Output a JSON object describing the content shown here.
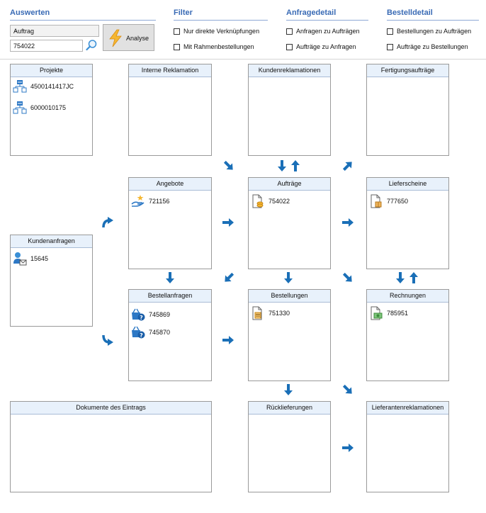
{
  "sections": {
    "auswerten": {
      "title": "Auswerten"
    },
    "filter": {
      "title": "Filter",
      "cb1": "Nur direkte Verknüpfungen",
      "cb2": "Mit Rahmenbestellungen"
    },
    "anfragedetail": {
      "title": "Anfragedetail",
      "cb1": "Anfragen zu Aufträgen",
      "cb2": "Aufträge zu Anfragen"
    },
    "bestelldetail": {
      "title": "Bestelldetail",
      "cb1": "Bestellungen zu Aufträgen",
      "cb2": "Aufträge zu Bestellungen"
    }
  },
  "controls": {
    "type_select": "Auftrag",
    "number_input": "754022",
    "analyse_label": "Analyse"
  },
  "panels": {
    "projekte": {
      "title": "Projekte",
      "items": [
        "4500141417JC",
        "6000010175"
      ]
    },
    "interne_reklamation": {
      "title": "Interne Reklamation"
    },
    "kundenreklamationen": {
      "title": "Kundenreklamationen"
    },
    "fertigungsauftraege": {
      "title": "Fertigungsaufträge"
    },
    "angebote": {
      "title": "Angebote",
      "items": [
        "721156"
      ]
    },
    "auftraege": {
      "title": "Aufträge",
      "items": [
        "754022"
      ]
    },
    "lieferscheine": {
      "title": "Lieferscheine",
      "items": [
        "777650"
      ]
    },
    "kundenanfragen": {
      "title": "Kundenanfragen",
      "items": [
        "15645"
      ]
    },
    "bestellanfragen": {
      "title": "Bestellanfragen",
      "items": [
        "745869",
        "745870"
      ]
    },
    "bestellungen": {
      "title": "Bestellungen",
      "items": [
        "751330"
      ]
    },
    "rechnungen": {
      "title": "Rechnungen",
      "items": [
        "785951"
      ]
    },
    "dokumente": {
      "title": "Dokumente des Eintrags"
    },
    "ruecklieferungen": {
      "title": "Rücklieferungen"
    },
    "lieferantenreklamationen": {
      "title": "Lieferantenreklamationen"
    }
  },
  "icons": {
    "select_chevron": "chevron-down-icon",
    "search": "search-icon",
    "analyse": "lightning-icon",
    "project": "hierarchy-icon",
    "offer": "hand-star-icon",
    "order": "document-coins-icon",
    "delivery_note": "document-box-icon",
    "customer_inquiry": "person-mail-icon",
    "purchase_request": "basket-question-icon",
    "purchase_order": "document-list-icon",
    "invoice": "document-money-icon",
    "flow_arrow": "arrow-icon"
  },
  "colors": {
    "accent": "#3a6bb5",
    "arrow": "#1a6fb7",
    "panel_header": "#e8f1fb"
  }
}
